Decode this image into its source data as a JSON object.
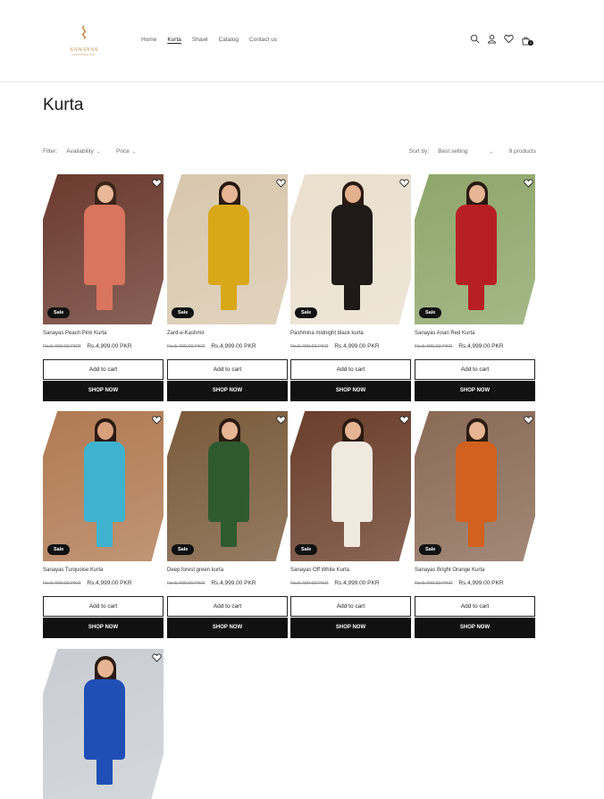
{
  "header": {
    "logo_text": "SANAYAS",
    "logo_sub": "CLOTHING CO.",
    "nav": [
      {
        "label": "Home",
        "active": false
      },
      {
        "label": "Kurta",
        "active": true
      },
      {
        "label": "Shawl",
        "active": false
      },
      {
        "label": "Catalog",
        "active": false
      },
      {
        "label": "Contact us",
        "active": false
      }
    ],
    "cart_count": "1"
  },
  "collection": {
    "title": "Kurta",
    "filter_label": "Filter:",
    "filter_availability": "Availability",
    "filter_price": "Price",
    "sort_label": "Sort by:",
    "sort_value": "Best selling",
    "count": "9 products"
  },
  "labels": {
    "sale": "Sale",
    "add_to_cart": "Add to cart",
    "shop_now": "SHOP NOW"
  },
  "products": [
    {
      "name": "Sanayas Peach Pink Kurta",
      "old_price": "Rs.5,499.00 PKR",
      "price": "Rs.4,999.00 PKR",
      "bg": "#6b3a2e",
      "dress": "#d9745e",
      "hair": "#3a2418",
      "skin": "#e8b897",
      "legs": "#d9745e"
    },
    {
      "name": "Zard-e-Kashmir",
      "old_price": "Rs.5,499.00 PKR",
      "price": "Rs.4,999.00 PKR",
      "bg": "#d8c7ad",
      "dress": "#d9a819",
      "hair": "#2a1a12",
      "skin": "#e6b593",
      "legs": "#d9a819"
    },
    {
      "name": "Pashmina midnight black kurta",
      "old_price": "Rs.5,499.00 PKR",
      "price": "Rs.4,999.00 PKR",
      "bg": "#e9dfcd",
      "dress": "#1f1a17",
      "hair": "#2a1a12",
      "skin": "#e4b18f",
      "legs": "#1f1a17"
    },
    {
      "name": "Sanayas Anari Red Kurta",
      "old_price": "Rs.5,499.00 PKR",
      "price": "Rs.4,999.00 PKR",
      "bg": "#8ea66a",
      "dress": "#b81f24",
      "hair": "#2a1a12",
      "skin": "#e6b593",
      "legs": "#b81f24"
    },
    {
      "name": "Sanayas Turquoise Kurta",
      "old_price": "Rs.5,499.00 PKR",
      "price": "Rs.4,999.00 PKR",
      "bg": "#b07a52",
      "dress": "#3fb2d0",
      "hair": "#2a1a12",
      "skin": "#d9a07c",
      "legs": "#3fb2d0"
    },
    {
      "name": "Deep forest green kurta",
      "old_price": "Rs.5,499.00 PKR",
      "price": "Rs.4,999.00 PKR",
      "bg": "#7a5a3a",
      "dress": "#2f5a2f",
      "hair": "#2a1a12",
      "skin": "#e6b593",
      "legs": "#2f5a2f"
    },
    {
      "name": "Sanayas Off White Kurta",
      "old_price": "Rs.5,499.00 PKR",
      "price": "Rs.4,999.00 PKR",
      "bg": "#6a3e2a",
      "dress": "#efe9df",
      "hair": "#2a1a12",
      "skin": "#e6b593",
      "legs": "#efe9df"
    },
    {
      "name": "Sanayas Bright Orange Kurta",
      "old_price": "Rs.5,499.00 PKR",
      "price": "Rs.4,999.00 PKR",
      "bg": "#8a6a55",
      "dress": "#d2601e",
      "hair": "#2a1a12",
      "skin": "#e6b593",
      "legs": "#d2601e"
    },
    {
      "name": "",
      "old_price": "",
      "price": "",
      "bg": "#c9cdd3",
      "dress": "#1f4fb5",
      "hair": "#2a1a12",
      "skin": "#e6b593",
      "legs": "#1f4fb5"
    }
  ]
}
